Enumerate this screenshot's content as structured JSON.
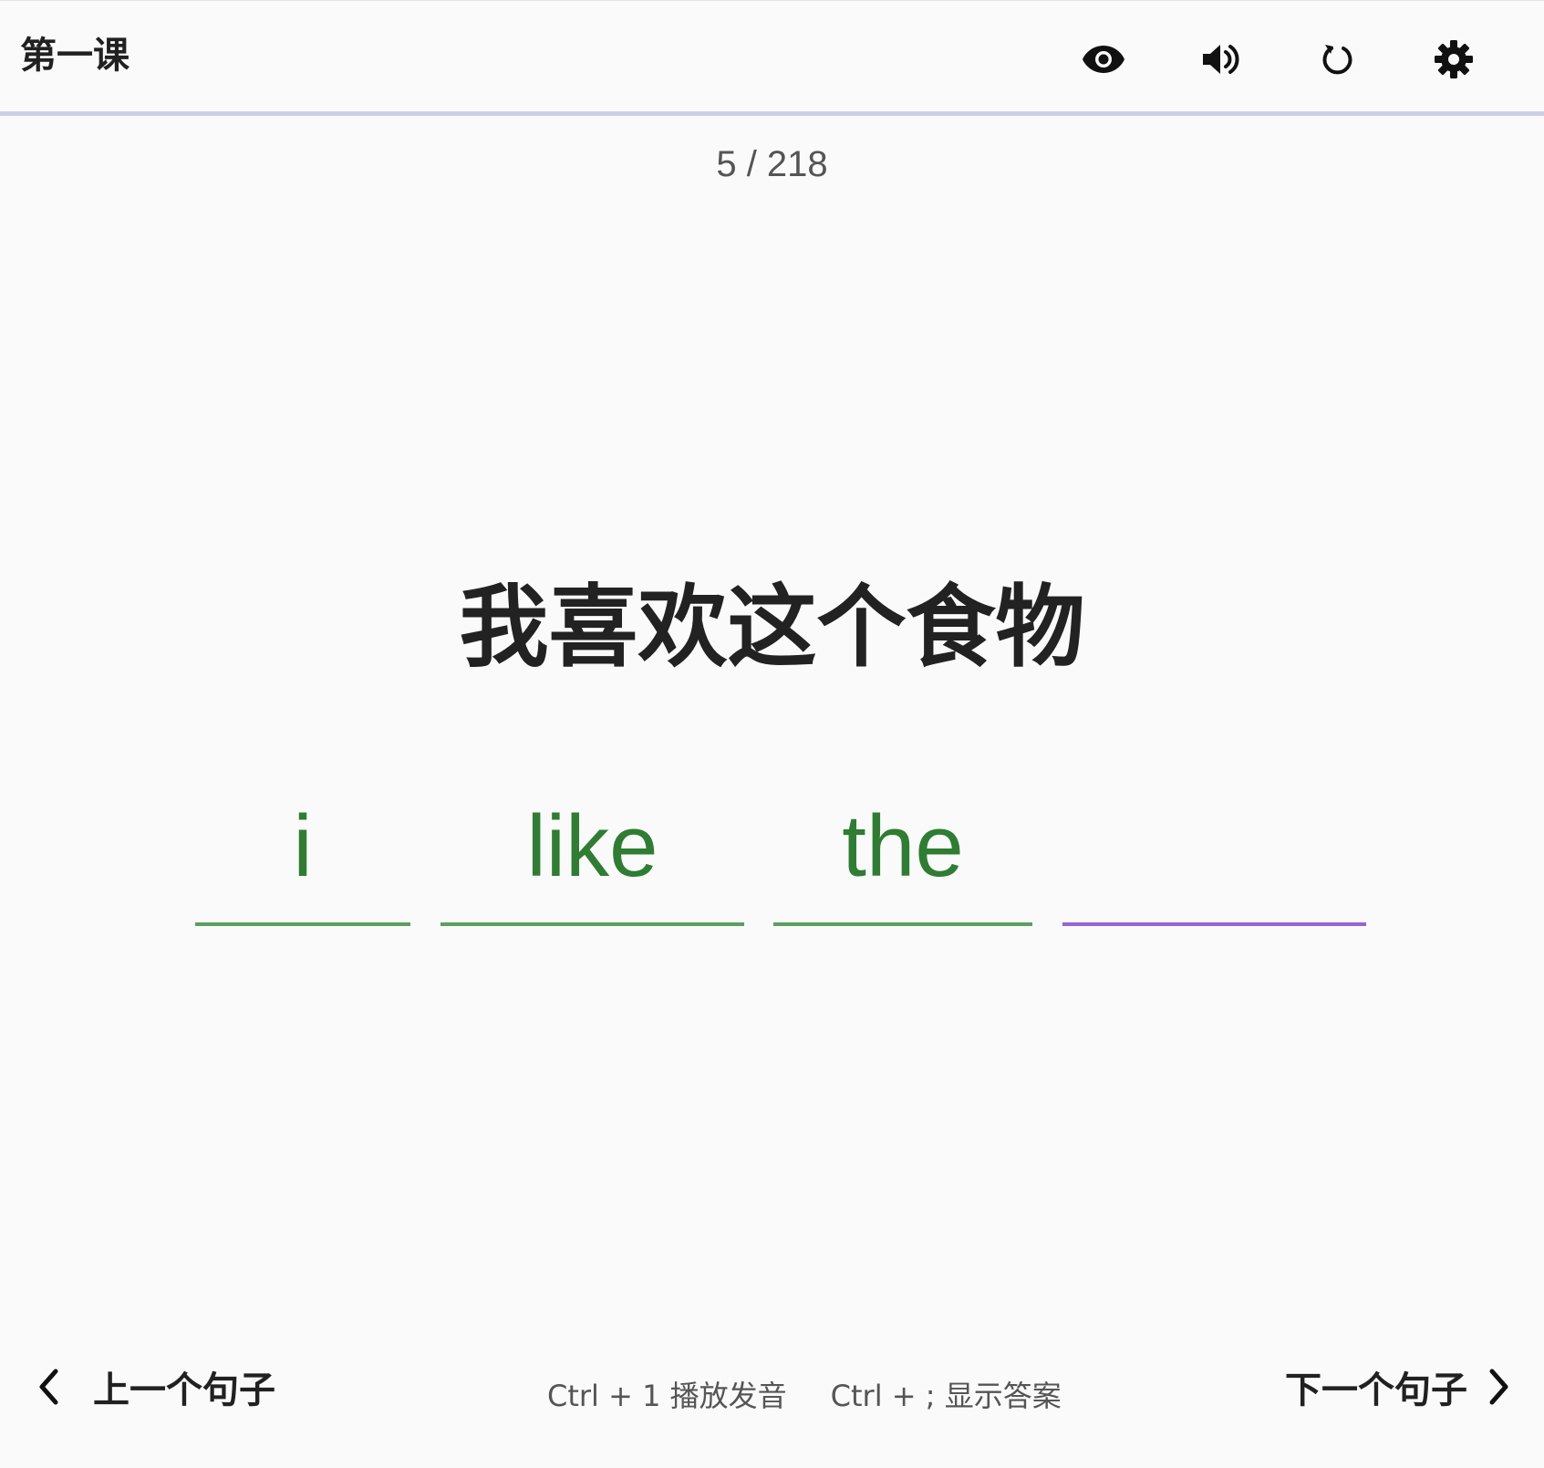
{
  "header": {
    "course_title": "第一课",
    "icons": [
      "eye-icon",
      "volume-icon",
      "refresh-icon",
      "gear-icon"
    ]
  },
  "progress": {
    "current": 5,
    "total": 218,
    "label": "5 / 218"
  },
  "prompt": {
    "chinese": "我喜欢这个食物"
  },
  "answer_slots": [
    {
      "text": "i",
      "state": "correct"
    },
    {
      "text": "like",
      "state": "correct"
    },
    {
      "text": "the",
      "state": "correct"
    },
    {
      "text": "",
      "state": "active"
    }
  ],
  "footer": {
    "prev_label": "上一个句子",
    "next_label": "下一个句子",
    "shortcut_play": "Ctrl + 1 播放发音",
    "shortcut_answer": "Ctrl + ; 显示答案"
  },
  "colors": {
    "correct_text": "#2e7d32",
    "correct_underline": "#5aa05e",
    "active_underline": "#9b62d1",
    "header_divider": "#cdd0e3"
  }
}
